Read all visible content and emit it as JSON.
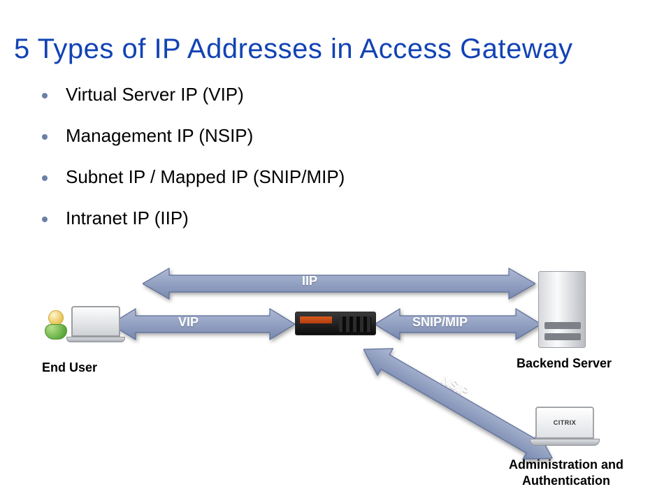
{
  "title": "5 Types of IP Addresses in Access Gateway",
  "bullets": [
    "Virtual Server IP (VIP)",
    "Management IP (NSIP)",
    "Subnet IP / Mapped IP (SNIP/MIP)",
    "Intranet IP (IIP)"
  ],
  "diagram": {
    "nodes": {
      "end_user": "End User",
      "backend": "Backend Server",
      "admin": "Administration and Authentication",
      "appliance_brand": "CITRIX"
    },
    "arrows": {
      "vip": "VIP",
      "snip": "SNIP/MIP",
      "iip": "IIP",
      "nsip": "NSIP"
    },
    "colors": {
      "arrow_fill_light": "#9aa7c7",
      "arrow_fill_dark": "#6e7fa9",
      "arrow_stroke": "#5e6f99"
    }
  }
}
